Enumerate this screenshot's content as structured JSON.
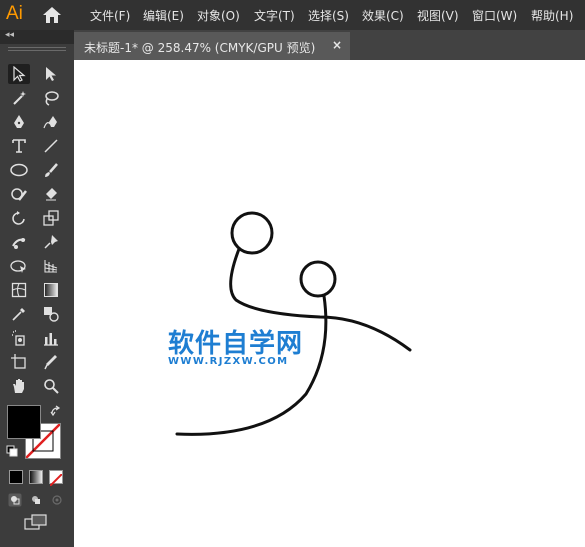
{
  "app": {
    "logo": "Ai"
  },
  "menu": [
    {
      "label": "文件(F)"
    },
    {
      "label": "编辑(E)"
    },
    {
      "label": "对象(O)"
    },
    {
      "label": "文字(T)"
    },
    {
      "label": "选择(S)"
    },
    {
      "label": "效果(C)"
    },
    {
      "label": "视图(V)"
    },
    {
      "label": "窗口(W)"
    },
    {
      "label": "帮助(H)"
    }
  ],
  "panel": {
    "collapse_label": "◂◂"
  },
  "document_tab": {
    "title": "未标题-1* @ 258.47% (CMYK/GPU 预览)",
    "close_label": "×"
  },
  "watermark": {
    "title": "软件自学网",
    "url": "WWW.RJZXW.COM"
  },
  "colors": {
    "menubar": "#323232",
    "toolbar": "#3c3c3c",
    "tab_active": "#595959",
    "canvas": "#ffffff",
    "accent": "#ff9a00",
    "watermark": "#1e7ed2"
  },
  "tools": [
    "selection-tool",
    "direct-selection-tool",
    "magic-wand-tool",
    "lasso-tool",
    "pen-tool",
    "curvature-tool",
    "type-tool",
    "line-segment-tool",
    "ellipse-tool",
    "paintbrush-tool",
    "shaper-tool",
    "eraser-tool",
    "rotate-tool",
    "scale-tool",
    "puppet-warp-tool",
    "pin-tool",
    "free-transform-tool",
    "perspective-grid-tool",
    "mesh-tool",
    "gradient-tool",
    "eyedropper-tool",
    "blend-tool",
    "symbol-sprayer-tool",
    "column-graph-tool",
    "artboard-tool",
    "slice-tool",
    "hand-tool",
    "zoom-tool"
  ]
}
